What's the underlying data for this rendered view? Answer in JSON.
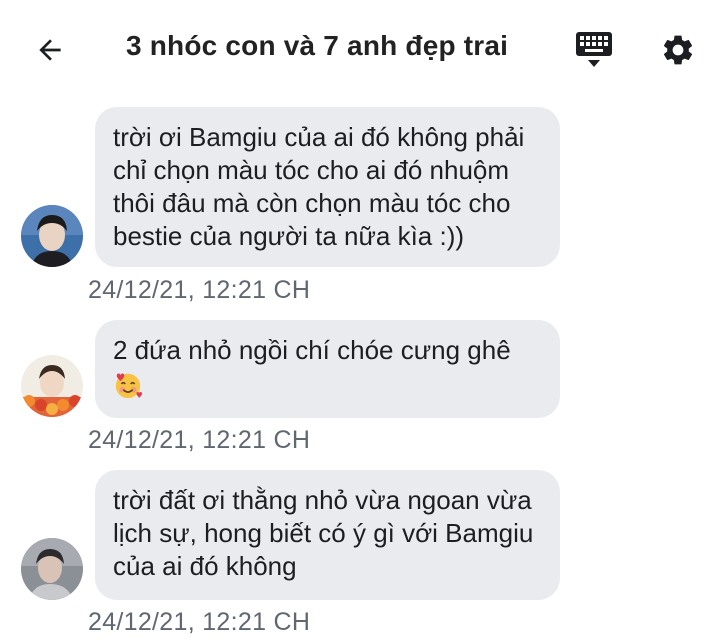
{
  "header": {
    "title": "3 nhóc con và 7 anh đẹp trai",
    "back_icon": "arrow-left-icon",
    "keyboard_icon": "keyboard-icon",
    "settings_icon": "gear-icon"
  },
  "messages": [
    {
      "lines": [
        "trời ơi Bamgiu của ai đó không phải",
        "chỉ chọn màu tóc cho ai đó nhuộm",
        "thôi đâu mà còn chọn màu tóc cho",
        "bestie của người ta nữa kìa :))"
      ],
      "timestamp": "24/12/21, 12:21 CH"
    },
    {
      "lines": [
        "2 đứa nhỏ ngồi chí chóe cưng ghê"
      ],
      "emoji": "smiling-face-with-hearts-icon",
      "timestamp": "24/12/21, 12:21 CH"
    },
    {
      "lines": [
        "trời đất ơi thằng nhỏ vừa ngoan vừa",
        "lịch sự, hong biết có ý gì với Bamgiu",
        "của ai đó không"
      ],
      "timestamp": "24/12/21, 12:21 CH"
    }
  ],
  "colors": {
    "bubble": "#e9ebef",
    "timestamp": "#606770",
    "title": "#222222"
  }
}
